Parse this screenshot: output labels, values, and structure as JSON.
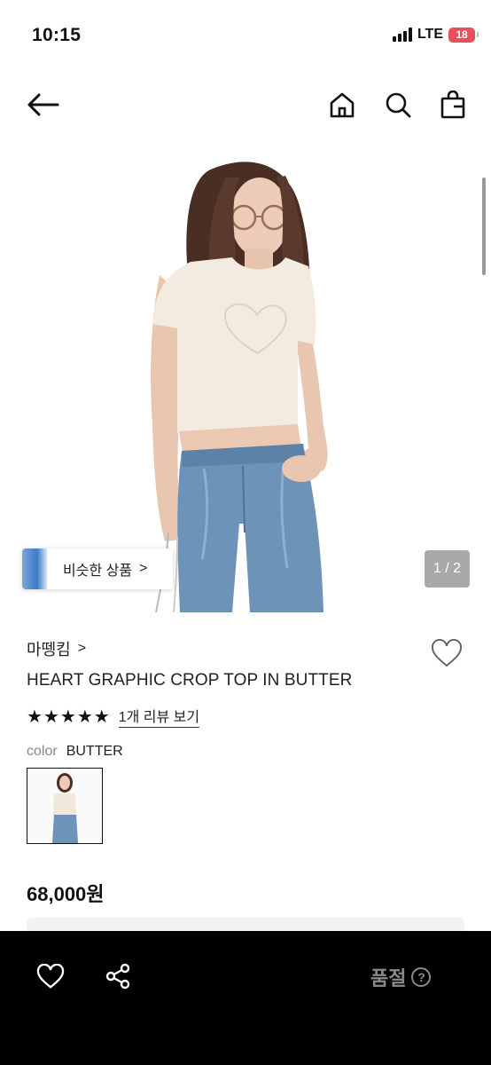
{
  "status_bar": {
    "time": "10:15",
    "network": "LTE",
    "battery": "18"
  },
  "nav": {
    "back_icon": "arrow-left-icon",
    "home_icon": "home-icon",
    "search_icon": "search-icon",
    "bag_icon": "shopping-bag-icon"
  },
  "gallery": {
    "similar_label": "비슷한 상품",
    "similar_arrow": ">",
    "page_indicator": "1 / 2"
  },
  "product": {
    "brand": "마뗑킴",
    "brand_arrow": ">",
    "title": "HEART GRAPHIC CROP TOP IN BUTTER",
    "rating_stars": 5,
    "review_link": "1개 리뷰 보기",
    "color_label": "color",
    "color_value": "BUTTER",
    "price": "68,000원"
  },
  "bottom_bar": {
    "soldout_label": "품절",
    "help_icon": "question-circle-icon"
  },
  "colors": {
    "accent": "#000000",
    "muted": "#8a8a8a",
    "battery": "#e8505b"
  }
}
